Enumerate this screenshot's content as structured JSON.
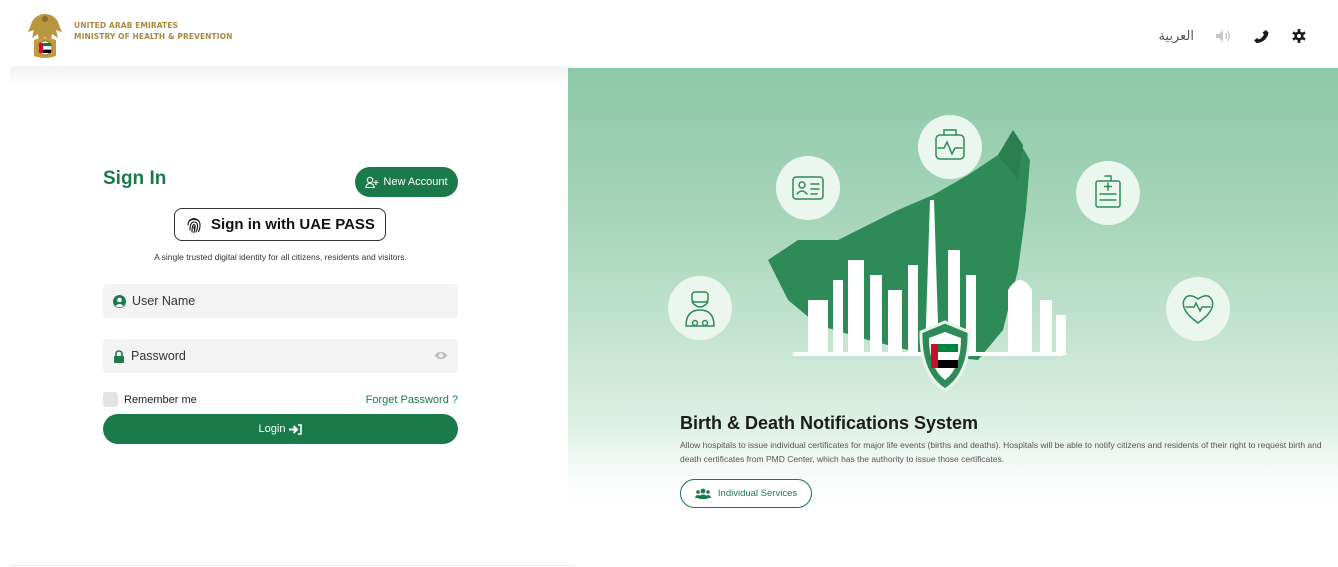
{
  "header": {
    "org_line1": "UNITED ARAB EMIRATES",
    "org_line2": "MINISTRY OF HEALTH & PREVENTION",
    "language_link": "العربية",
    "icons": [
      "emblem-icon",
      "speaker-icon",
      "phone-icon",
      "gear-icon"
    ]
  },
  "signin": {
    "title": "Sign In",
    "new_account_label": "New Account",
    "uaepass_label": "Sign in with UAE PASS",
    "uaepass_description": "A single trusted digital identity for all citizens, residents and visitors.",
    "username_placeholder": "User Name",
    "password_placeholder": "Password",
    "remember_label": "Remember me",
    "forget_label": "Forget Password ?",
    "login_label": "Login"
  },
  "promo": {
    "title": "Birth & Death Notifications System",
    "description": "Allow hospitals to issue individual certificates for major life events (births and deaths). Hospitals will be able to notify citizens and residents of their right to request birth and death certificates from PMD Center, which has the authority to issue those certificates.",
    "individual_services_label": "Individual Services"
  },
  "colors": {
    "brand_green": "#1a7a4a",
    "gold": "#a88a3f",
    "panel_green": "#8cc8a7"
  }
}
